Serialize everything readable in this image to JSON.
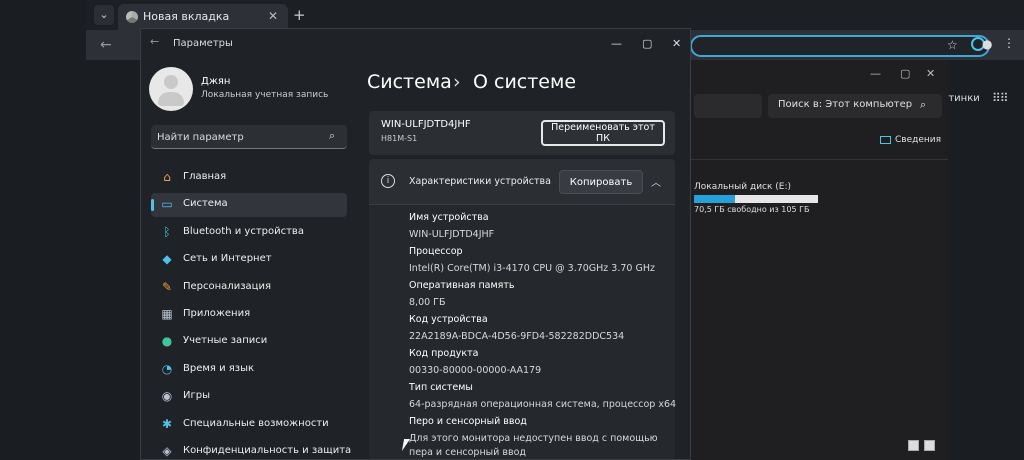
{
  "browser": {
    "tab_title": "Новая вкладка",
    "close_glyph": "✕",
    "new_tab_glyph": "+",
    "back_glyph": "←"
  },
  "explorer": {
    "search_placeholder": "Поиск в: Этот компьютер",
    "details_label": "Сведения",
    "drive_name": "Локальный диск (E:)",
    "drive_free": "70,5 ГБ свободно из 105 ГБ",
    "drive_used_fraction": 0.33,
    "right_edge_text": "ртинки"
  },
  "settings": {
    "window_title": "Параметры",
    "user": {
      "name": "Джян",
      "account_type": "Локальная учетная запись"
    },
    "search_placeholder": "Найти параметр",
    "nav": [
      {
        "label": "Главная",
        "icon": "home-icon",
        "glyph": "⌂",
        "color": "#e8a15c"
      },
      {
        "label": "Система",
        "icon": "system-icon",
        "glyph": "▭",
        "color": "#4cc3e8",
        "active": true
      },
      {
        "label": "Bluetooth и устройства",
        "icon": "bluetooth-icon",
        "glyph": "ᛒ",
        "color": "#4cc3e8"
      },
      {
        "label": "Сеть и Интернет",
        "icon": "network-icon",
        "glyph": "◆",
        "color": "#4cc3e8"
      },
      {
        "label": "Персонализация",
        "icon": "brush-icon",
        "glyph": "✎",
        "color": "#f0a040"
      },
      {
        "label": "Приложения",
        "icon": "apps-icon",
        "glyph": "▦",
        "color": "#b8c4d0"
      },
      {
        "label": "Учетные записи",
        "icon": "accounts-icon",
        "glyph": "●",
        "color": "#3fc59a"
      },
      {
        "label": "Время и язык",
        "icon": "time-language-icon",
        "glyph": "◔",
        "color": "#4cc3e8"
      },
      {
        "label": "Игры",
        "icon": "gaming-icon",
        "glyph": "◉",
        "color": "#b8c4d0"
      },
      {
        "label": "Специальные возможности",
        "icon": "accessibility-icon",
        "glyph": "✱",
        "color": "#4cc3e8"
      },
      {
        "label": "Конфиденциальность и защита",
        "icon": "privacy-icon",
        "glyph": "◈",
        "color": "#b8c4d0"
      }
    ],
    "breadcrumb": {
      "section": "Система",
      "separator": "›",
      "page": "О системе"
    },
    "pc": {
      "name": "WIN-ULFJDTD4JHF",
      "model": "H81M-S1",
      "rename_label": "Переименовать этот ПК"
    },
    "specs": {
      "title": "Характеристики устройства",
      "copy_label": "Копировать",
      "info_glyph": "i",
      "collapse_glyph": "︿",
      "items": [
        {
          "label": "Имя устройства",
          "value": "WIN-ULFJDTD4JHF"
        },
        {
          "label": "Процессор",
          "value": "Intel(R) Core(TM) i3-4170 CPU @ 3.70GHz   3.70 GHz"
        },
        {
          "label": "Оперативная память",
          "value": "8,00 ГБ"
        },
        {
          "label": "Код устройства",
          "value": "22A2189A-BDCA-4D56-9FD4-582282DDC534"
        },
        {
          "label": "Код продукта",
          "value": "00330-80000-00000-AA179"
        },
        {
          "label": "Тип системы",
          "value": "64-разрядная операционная система, процессор x64"
        },
        {
          "label": "Перо и сенсорный ввод",
          "value": "Для этого монитора недоступен ввод с помощью",
          "value2": "пера и сенсорный ввод"
        }
      ]
    }
  }
}
